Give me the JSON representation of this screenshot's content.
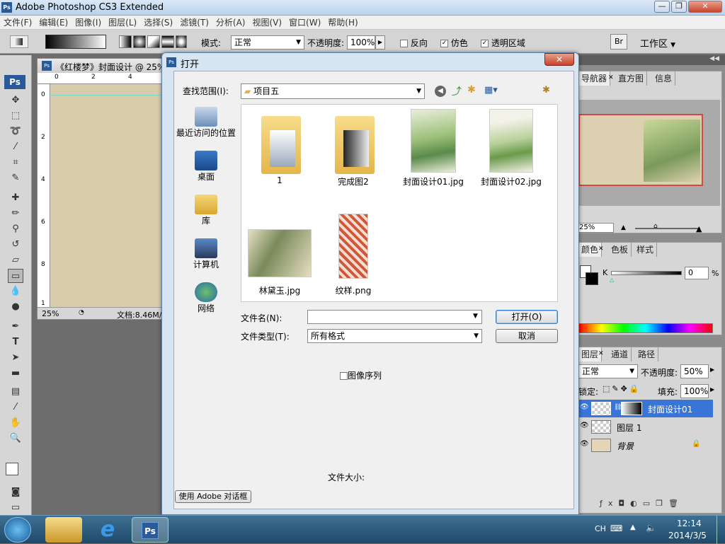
{
  "app": {
    "title": "Adobe Photoshop CS3 Extended",
    "logo": "Ps"
  },
  "window_buttons": [
    "—",
    "❐",
    "✕"
  ],
  "menu": [
    "文件(F)",
    "编辑(E)",
    "图像(I)",
    "图层(L)",
    "选择(S)",
    "滤镜(T)",
    "分析(A)",
    "视图(V)",
    "窗口(W)",
    "帮助(H)"
  ],
  "options": {
    "mode_label": "模式:",
    "mode_value": "正常",
    "opacity_label": "不透明度:",
    "opacity_value": "100%",
    "reverse_label": "反向",
    "dither_label": "仿色",
    "transparency_label": "透明区域",
    "workspace_label": "工作区"
  },
  "document": {
    "title": "《红楼梦》封面设计 @ 25%",
    "zoom": "25%",
    "doc_info": "文档:8.46M/",
    "ruler_h": [
      "0",
      "2",
      "4"
    ],
    "ruler_v": [
      "0",
      "2",
      "4",
      "6",
      "8",
      "1"
    ]
  },
  "navigator": {
    "tabs": [
      "导航器",
      "直方图",
      "信息"
    ],
    "zoom": "25%"
  },
  "color_panel": {
    "tabs": [
      "颜色",
      "色板",
      "样式"
    ],
    "k_label": "K",
    "k_value": "0",
    "k_unit": "%"
  },
  "layers_panel": {
    "tabs": [
      "图层",
      "通道",
      "路径"
    ],
    "blend": "正常",
    "opacity_label": "不透明度:",
    "opacity_value": "50%",
    "lock_label": "锁定:",
    "fill_label": "填充:",
    "fill_value": "100%",
    "layers": [
      {
        "name": "封面设计01",
        "selected": true
      },
      {
        "name": "图层 1",
        "selected": false
      },
      {
        "name": "背景",
        "selected": false
      }
    ]
  },
  "dialog": {
    "title": "打开",
    "lookin_label": "查找范围(I):",
    "lookin_value": "项目五",
    "places": [
      "最近访问的位置",
      "桌面",
      "库",
      "计算机",
      "网络"
    ],
    "files": [
      {
        "name": "1",
        "kind": "folder"
      },
      {
        "name": "完成图2",
        "kind": "folder"
      },
      {
        "name": "封面设计01.jpg",
        "kind": "image"
      },
      {
        "name": "封面设计02.jpg",
        "kind": "image"
      },
      {
        "name": "林黛玉.jpg",
        "kind": "image"
      },
      {
        "name": "纹样.png",
        "kind": "image"
      }
    ],
    "filename_label": "文件名(N):",
    "filename_value": "",
    "filetype_label": "文件类型(T):",
    "filetype_value": "所有格式",
    "open_button": "打开(O)",
    "cancel_button": "取消",
    "sequence_label": "图像序列",
    "filesize_label": "文件大小:",
    "adobe_dialog_button": "使用 Adobe 对话框"
  },
  "taskbar": {
    "lang": "CH",
    "time": "12:14",
    "date": "2014/3/5"
  }
}
